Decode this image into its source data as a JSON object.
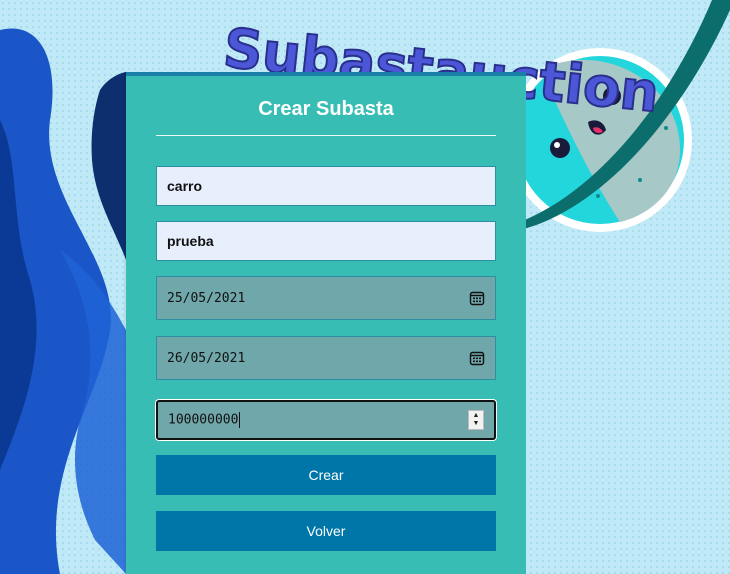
{
  "brand": {
    "logo_text": "Subastauction"
  },
  "form": {
    "title": "Crear Subasta",
    "fields": {
      "name": {
        "value": "carro"
      },
      "description": {
        "value": "prueba"
      },
      "start_date": {
        "value": "25/05/2021",
        "icon": "calendar-icon"
      },
      "end_date": {
        "value": "26/05/2021",
        "icon": "calendar-icon"
      },
      "price": {
        "value": "100000000",
        "icon": "spinner-icon"
      }
    },
    "buttons": {
      "create_label": "Crear",
      "back_label": "Volver"
    }
  },
  "colors": {
    "card_bg": "#38bdb5",
    "card_border": "#1a7fa8",
    "button_bg": "#0076a8",
    "text_input_bg": "#e8effc",
    "date_input_bg": "#70a7ab",
    "page_bg": "#bfe9f6"
  }
}
